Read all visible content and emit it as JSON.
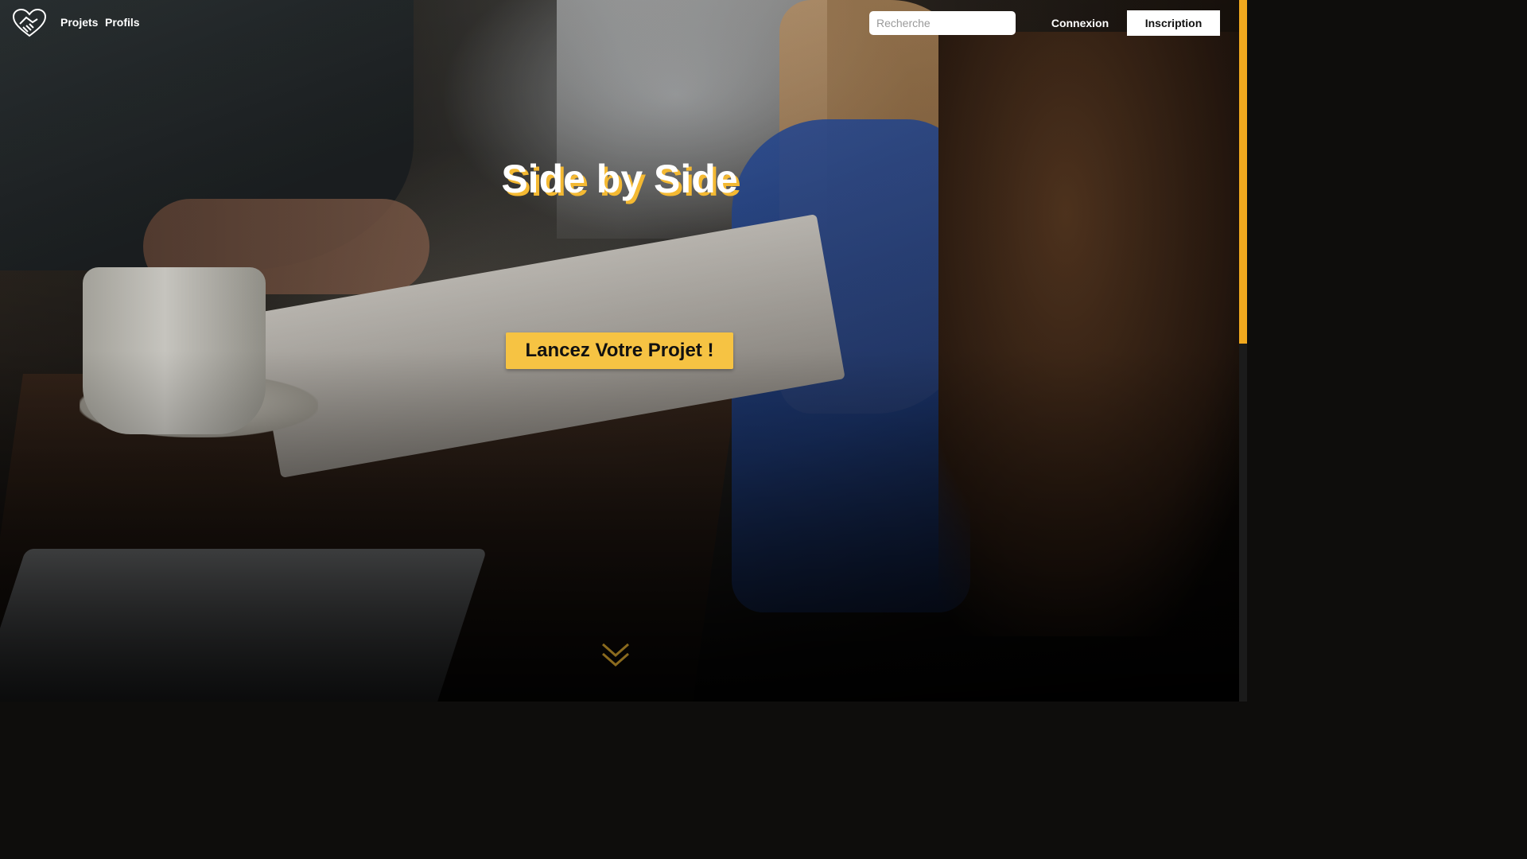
{
  "navbar": {
    "logo_icon": "handshake-heart-icon",
    "links": [
      {
        "label": "Projets"
      },
      {
        "label": "Profils"
      }
    ],
    "search": {
      "placeholder": "Recherche",
      "value": ""
    },
    "login_label": "Connexion",
    "signup_label": "Inscription"
  },
  "hero": {
    "title": "Side by Side",
    "cta_label": "Lancez Votre Projet !",
    "scroll_icon": "double-chevron-down-icon"
  },
  "colors": {
    "accent": "#f6c343",
    "title_shadow": "#f4b932",
    "scrollbar": "#f0a81e"
  }
}
